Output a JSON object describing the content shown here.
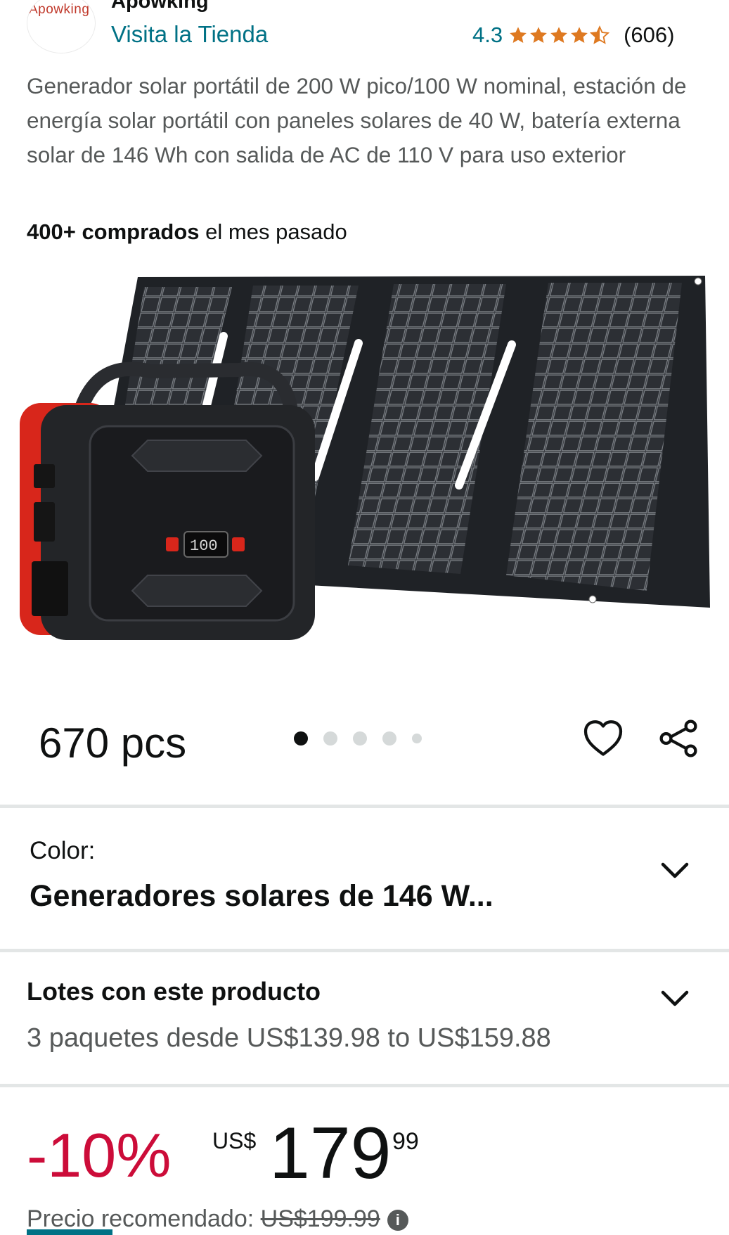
{
  "store": {
    "logo_text": "Apowking",
    "brand_name": "Apowking",
    "visit_label": "Visita la Tienda",
    "rating": "4.3",
    "rating_value": 4.3,
    "review_count": "(606)",
    "star_color": "#de7921"
  },
  "product": {
    "title": "Generador solar portátil de 200 W pico/100 W nominal, estación de energía solar portátil con paneles solares de 40 W, batería externa solar de 146 Wh con salida de AC de 110 V para uso exterior",
    "bought_bold": "400+ comprados",
    "bought_rest": " el mes pasado",
    "image_text_quantity": "670 pcs",
    "image_display_text": "100",
    "image_count": 5,
    "active_image_index": 0
  },
  "icons": {
    "favorite": "heart-icon",
    "share": "share-icon",
    "expand": "chevron-down-icon",
    "info": "info-icon"
  },
  "color_selector": {
    "label": "Color:",
    "value": "Generadores solares de 146 W..."
  },
  "bundles": {
    "title": "Lotes con este producto",
    "subtitle": "3 paquetes desde US$139.98 to US$159.88"
  },
  "pricing": {
    "discount": "-10%",
    "currency": "US$",
    "whole": "179",
    "fraction": "99",
    "list_price_label": "Precio recomendado: ",
    "list_price": "US$199.99",
    "discount_color": "#cc0c39"
  }
}
